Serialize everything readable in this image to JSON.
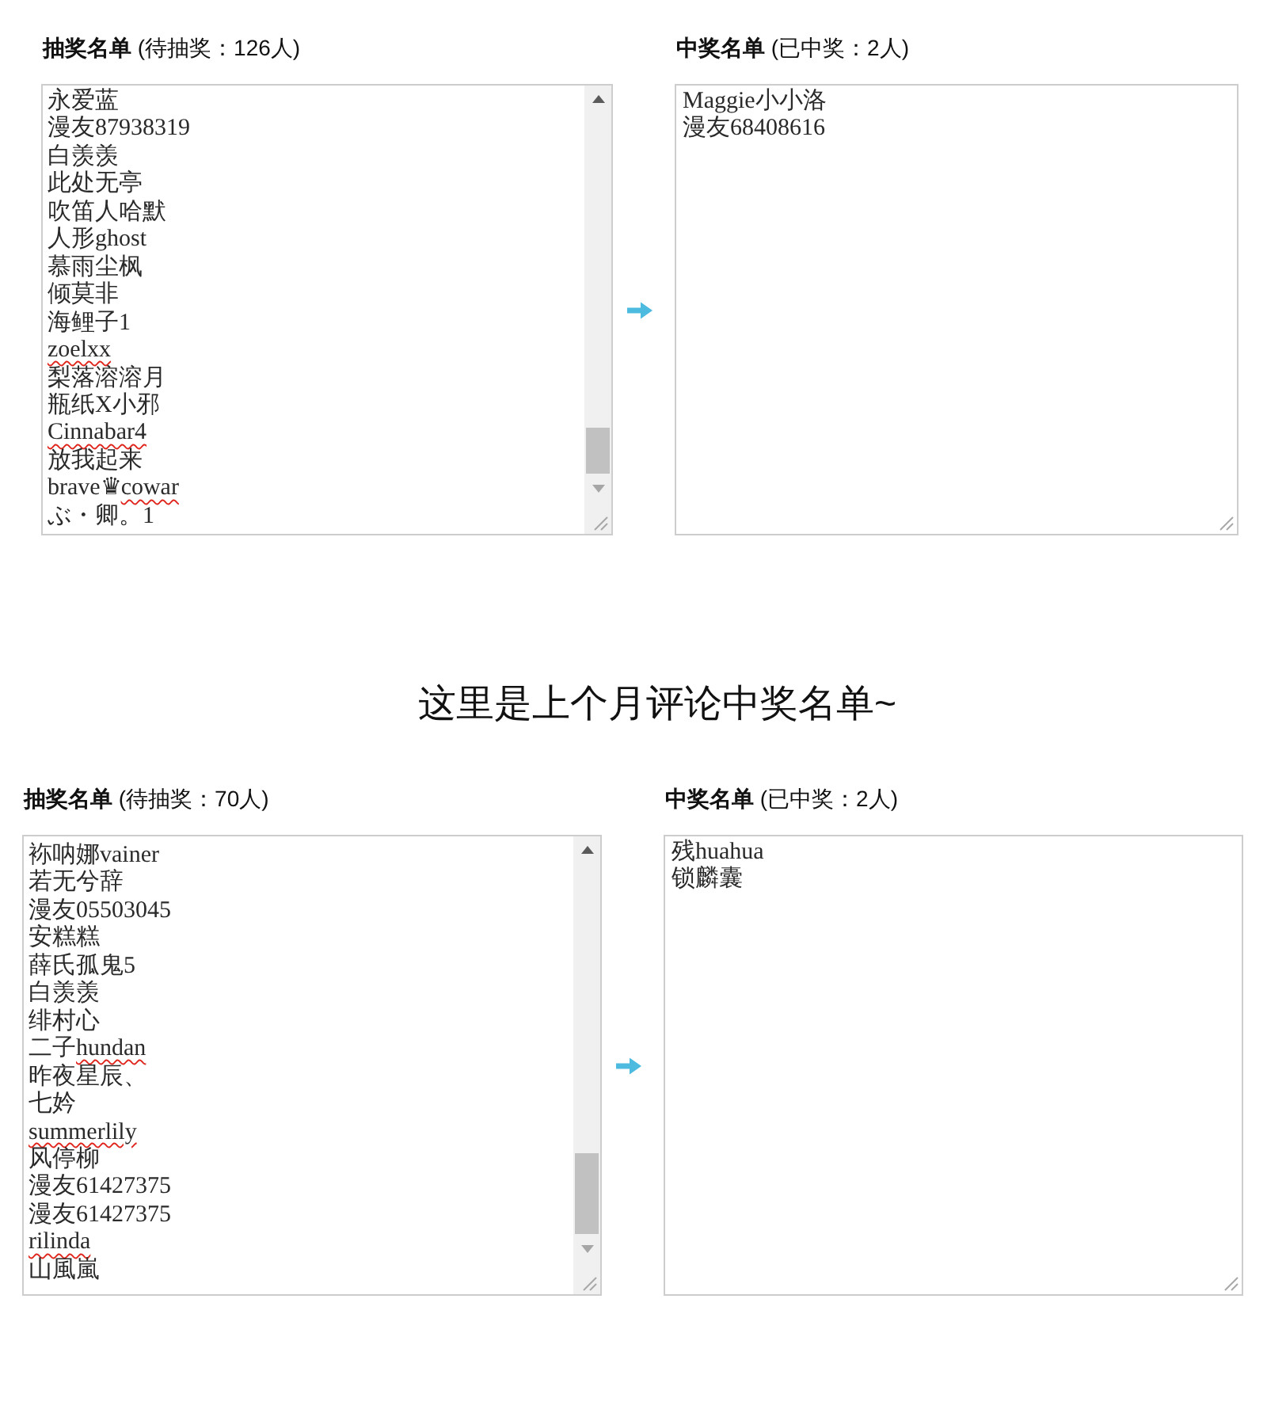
{
  "lottery": {
    "pool": {
      "title": "**抽奖名单** (待抽奖：126人)",
      "entries": [
        {
          "parts": [
            {
              "text": "永爱蓝",
              "spell_error": false
            }
          ]
        },
        {
          "parts": [
            {
              "text": "漫友87938319",
              "spell_error": false
            }
          ]
        },
        {
          "parts": [
            {
              "text": "白羡羡",
              "spell_error": false
            }
          ]
        },
        {
          "parts": [
            {
              "text": "此处无亭",
              "spell_error": false
            }
          ]
        },
        {
          "parts": [
            {
              "text": "吹笛人哈默",
              "spell_error": false
            }
          ]
        },
        {
          "parts": [
            {
              "text": "人形ghost",
              "spell_error": false
            }
          ]
        },
        {
          "parts": [
            {
              "text": "慕雨尘枫",
              "spell_error": false
            }
          ]
        },
        {
          "parts": [
            {
              "text": "倾莫非",
              "spell_error": false
            }
          ]
        },
        {
          "parts": [
            {
              "text": "海鲤子1",
              "spell_error": false
            }
          ]
        },
        {
          "parts": [
            {
              "text": "zoelxx",
              "spell_error": true
            }
          ]
        },
        {
          "parts": [
            {
              "text": "梨落溶溶月",
              "spell_error": false
            }
          ]
        },
        {
          "parts": [
            {
              "text": "瓶纸X小邪",
              "spell_error": false
            }
          ]
        },
        {
          "parts": [
            {
              "text": "Cinnabar4",
              "spell_error": true
            }
          ]
        },
        {
          "parts": [
            {
              "text": "放我起来",
              "spell_error": false
            }
          ]
        },
        {
          "parts": [
            {
              "text": "brave♛",
              "spell_error": false
            },
            {
              "text": "cowar",
              "spell_error": true
            }
          ]
        },
        {
          "parts": [
            {
              "text": "ぶ・卿。1",
              "spell_error": false
            }
          ]
        }
      ]
    },
    "winners": {
      "title": "**中奖名单** (已中奖：2人)",
      "entries": [
        {
          "parts": [
            {
              "text": "Maggie小小洛",
              "spell_error": false
            }
          ]
        },
        {
          "parts": [
            {
              "text": "漫友68408616",
              "spell_error": false
            }
          ]
        }
      ]
    }
  },
  "heading": "这里是上个月评论中奖名单~",
  "last_month": {
    "pool": {
      "title": "**抽奖名单** (待抽奖：70人)",
      "entries": [
        {
          "parts": [
            {
              "text": "袮呐娜vainer",
              "spell_error": false
            }
          ]
        },
        {
          "parts": [
            {
              "text": "若无兮辞",
              "spell_error": false
            }
          ]
        },
        {
          "parts": [
            {
              "text": "漫友05503045",
              "spell_error": false
            }
          ]
        },
        {
          "parts": [
            {
              "text": "安糕糕",
              "spell_error": false
            }
          ]
        },
        {
          "parts": [
            {
              "text": "薛氏孤鬼5",
              "spell_error": false
            }
          ]
        },
        {
          "parts": [
            {
              "text": "白羡羡",
              "spell_error": false
            }
          ]
        },
        {
          "parts": [
            {
              "text": "绯村心",
              "spell_error": false
            }
          ]
        },
        {
          "parts": [
            {
              "text": "二子",
              "spell_error": false
            },
            {
              "text": "hundan",
              "spell_error": true
            }
          ]
        },
        {
          "parts": [
            {
              "text": "昨夜星辰、",
              "spell_error": false
            }
          ]
        },
        {
          "parts": [
            {
              "text": "七妗",
              "spell_error": false
            }
          ]
        },
        {
          "parts": [
            {
              "text": "summerlily",
              "spell_error": true
            }
          ]
        },
        {
          "parts": [
            {
              "text": "风停柳",
              "spell_error": false
            }
          ]
        },
        {
          "parts": [
            {
              "text": "漫友61427375",
              "spell_error": false
            }
          ]
        },
        {
          "parts": [
            {
              "text": "漫友61427375",
              "spell_error": false
            }
          ]
        },
        {
          "parts": [
            {
              "text": "rilinda",
              "spell_error": true
            }
          ]
        },
        {
          "parts": [
            {
              "text": "山風嵐",
              "spell_error": false
            }
          ]
        }
      ]
    },
    "winners": {
      "title": "**中奖名单** (已中奖：2人)",
      "entries": [
        {
          "parts": [
            {
              "text": "残huahua",
              "spell_error": false
            }
          ]
        },
        {
          "parts": [
            {
              "text": "锁麟囊",
              "spell_error": false
            }
          ]
        }
      ]
    }
  }
}
